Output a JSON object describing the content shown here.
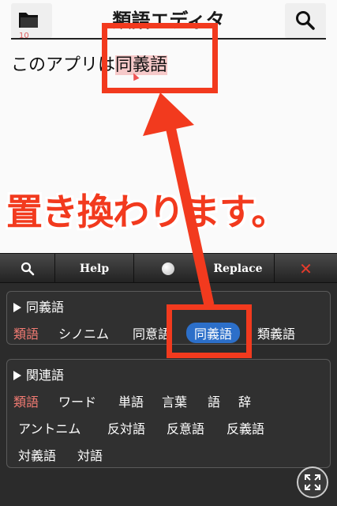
{
  "header": {
    "title": "類語エディタ",
    "folder_count": "10"
  },
  "editor": {
    "text_before": "このアプリは",
    "selected_text": "同義語"
  },
  "banner": "置き換わります。",
  "toolbar": {
    "help_label": "Help",
    "replace_label": "Replace",
    "close_label": "✕"
  },
  "synonyms": {
    "title": "同義語",
    "words": [
      "類語",
      "シノニム",
      "同意語",
      "同義語",
      "類義語"
    ]
  },
  "related": {
    "title": "関連語",
    "words": [
      "類語",
      "ワード",
      "単語",
      "言葉",
      "語",
      "辞",
      "アントニム",
      "反対語",
      "反意語",
      "反義語",
      "対義語",
      "対語"
    ]
  },
  "colors": {
    "accent_red": "#f23a1e",
    "selection_pill": "#2c6fc9",
    "first_word": "#f07a72"
  }
}
